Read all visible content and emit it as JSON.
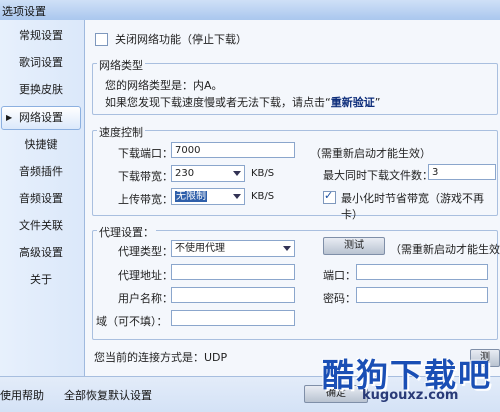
{
  "window": {
    "title": "选项设置"
  },
  "sidebar": {
    "items": [
      {
        "label": "常规设置"
      },
      {
        "label": "歌词设置"
      },
      {
        "label": "更换皮肤"
      },
      {
        "label": "网络设置"
      },
      {
        "label": "快捷键"
      },
      {
        "label": "音频插件"
      },
      {
        "label": "音频设置"
      },
      {
        "label": "文件关联"
      },
      {
        "label": "高级设置"
      },
      {
        "label": "关于"
      }
    ],
    "active_index": 3
  },
  "network": {
    "disable_label": "关闭网络功能（停止下载）",
    "disable_checked": false
  },
  "network_type": {
    "title": "网络类型",
    "type_line": "您的网络类型是：内A。",
    "hint_prefix": "如果您发现下载速度慢或者无法下载，请点击“",
    "hint_link": "重新验证",
    "hint_suffix": "”"
  },
  "speed": {
    "title": "速度控制",
    "port_label": "下载端口：",
    "port_value": "7000",
    "restart_note": "（需重新启动才能生效）",
    "down_label": "下载带宽：",
    "down_value": "230",
    "down_unit": "KB/S",
    "max_files_label": "最大同时下载文件数：",
    "max_files_value": "3",
    "up_label": "上传带宽：",
    "up_value": "无限制",
    "up_unit": "KB/S",
    "minimize_label": "最小化时节省带宽（游戏不再卡）",
    "minimize_checked": true
  },
  "proxy": {
    "title": "代理设置：",
    "type_label": "代理类型：",
    "type_value": "不使用代理",
    "test_button": "测试",
    "restart_note": "（需重新启动才能生效）",
    "addr_label": "代理地址：",
    "port_label": "端口：",
    "user_label": "用户名称：",
    "pass_label": "密码：",
    "domain_label": "域（可不填）："
  },
  "connection": {
    "text": "您当前的连接方式是：UDP"
  },
  "bottom": {
    "help_label": "使用帮助",
    "restore_label": "全部恢复默认设置",
    "ok_button": "确定",
    "partial_button": "测"
  },
  "watermark": {
    "title": "酷狗下载吧",
    "sub": "kugouxz.com"
  }
}
